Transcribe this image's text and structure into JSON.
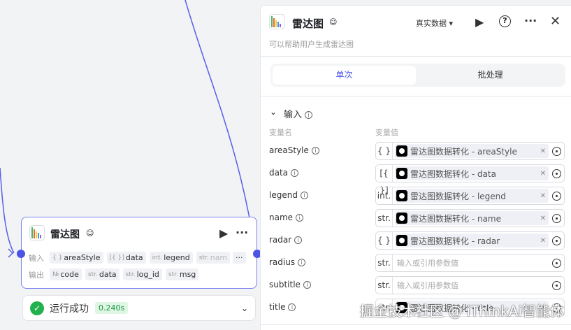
{
  "node": {
    "title": "雷达图",
    "input_label": "输入",
    "output_label": "输出",
    "inputs": [
      {
        "type": "{ }",
        "name": "areaStyle"
      },
      {
        "type": "[{ }]",
        "name": "data"
      },
      {
        "type": "int.",
        "name": "legend"
      },
      {
        "type": "str.",
        "name": "nam"
      }
    ],
    "outputs": [
      {
        "type": "№",
        "name": "code"
      },
      {
        "type": "str.",
        "name": "data"
      },
      {
        "type": "str.",
        "name": "log_id"
      },
      {
        "type": "str.",
        "name": "msg"
      }
    ],
    "more": "···"
  },
  "status": {
    "text": "运行成功",
    "time": "0.240s"
  },
  "panel": {
    "title": "雷达图",
    "description": "可以帮助用户生成雷达图",
    "data_mode": "真实数据",
    "tabs": [
      "单次",
      "批处理"
    ],
    "section": "输入",
    "col_name": "变量名",
    "col_value": "变量值",
    "placeholder": "输入或引用参数值",
    "rows": [
      {
        "name": "areaStyle",
        "type": "{ }",
        "ref": "雷达图数据转化 - areaStyle"
      },
      {
        "name": "data",
        "type": "[{ }]",
        "ref": "雷达图数据转化 - data"
      },
      {
        "name": "legend",
        "type": "int.",
        "ref": "雷达图数据转化 - legend"
      },
      {
        "name": "name",
        "type": "str.",
        "ref": "雷达图数据转化 - name"
      },
      {
        "name": "radar",
        "type": "{ }",
        "ref": "雷达图数据转化 - radar"
      },
      {
        "name": "radius",
        "type": "str.",
        "ref": null
      },
      {
        "name": "subtitle",
        "type": "str.",
        "ref": null
      },
      {
        "name": "title",
        "type": "str.",
        "ref": "雷达图数据转化 - title"
      }
    ]
  },
  "watermark": "掘金技术社区 @ iThinkAi智能体",
  "colors": {
    "accent": "#4c54e6",
    "success": "#22b14c"
  }
}
